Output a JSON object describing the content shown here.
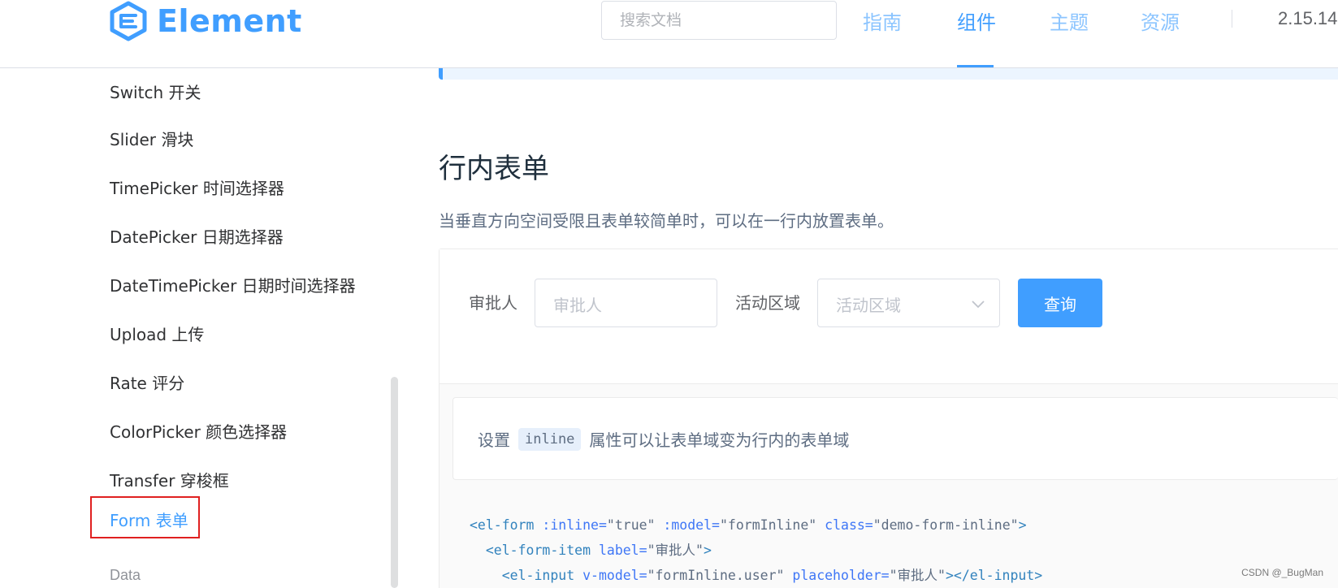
{
  "header": {
    "logo_text": "Element",
    "search_placeholder": "搜索文档",
    "nav": [
      {
        "label": "指南",
        "active": false
      },
      {
        "label": "组件",
        "active": true
      },
      {
        "label": "主题",
        "active": false
      },
      {
        "label": "资源",
        "active": false
      }
    ],
    "version": "2.15.14"
  },
  "sidebar": {
    "items": [
      {
        "label": "Switch 开关"
      },
      {
        "label": "Slider 滑块"
      },
      {
        "label": "TimePicker 时间选择器"
      },
      {
        "label": "DatePicker 日期选择器"
      },
      {
        "label": "DateTimePicker 日期时间选择器"
      },
      {
        "label": "Upload 上传"
      },
      {
        "label": "Rate 评分"
      },
      {
        "label": "ColorPicker 颜色选择器"
      },
      {
        "label": "Transfer 穿梭框"
      },
      {
        "label": "Form 表单"
      }
    ],
    "active_item": "Form 表单",
    "next_group": "Data"
  },
  "main": {
    "section_title": "行内表单",
    "section_desc": "当垂直方向空间受限且表单较简单时，可以在一行内放置表单。",
    "demo": {
      "label_approver": "审批人",
      "input_approver_placeholder": "审批人",
      "label_region": "活动区域",
      "select_region_placeholder": "活动区域",
      "query_button": "查询"
    },
    "description": {
      "prefix": "设置",
      "code": "inline",
      "suffix": "属性可以让表单域变为行内的表单域"
    },
    "code_lines": {
      "line1": {
        "tag": "<el-form",
        "a1": " :inline=",
        "v1": "\"true\"",
        "a2": " :model=",
        "v2": "\"formInline\"",
        "a3": " class=",
        "v3": "\"demo-form-inline\"",
        "end": ">"
      },
      "line2": {
        "tag": "<el-form-item",
        "a1": " label=",
        "v1": "\"审批人\"",
        "end": ">"
      },
      "line3": {
        "tag": "<el-input",
        "a1": " v-model=",
        "v1": "\"formInline.user\"",
        "a2": " placeholder=",
        "v2": "\"审批人\"",
        "end": "></el-input>"
      }
    }
  },
  "watermark": "CSDN @_BugMan",
  "colors": {
    "brand": "#409eff",
    "highlight_box": "#e02020"
  }
}
